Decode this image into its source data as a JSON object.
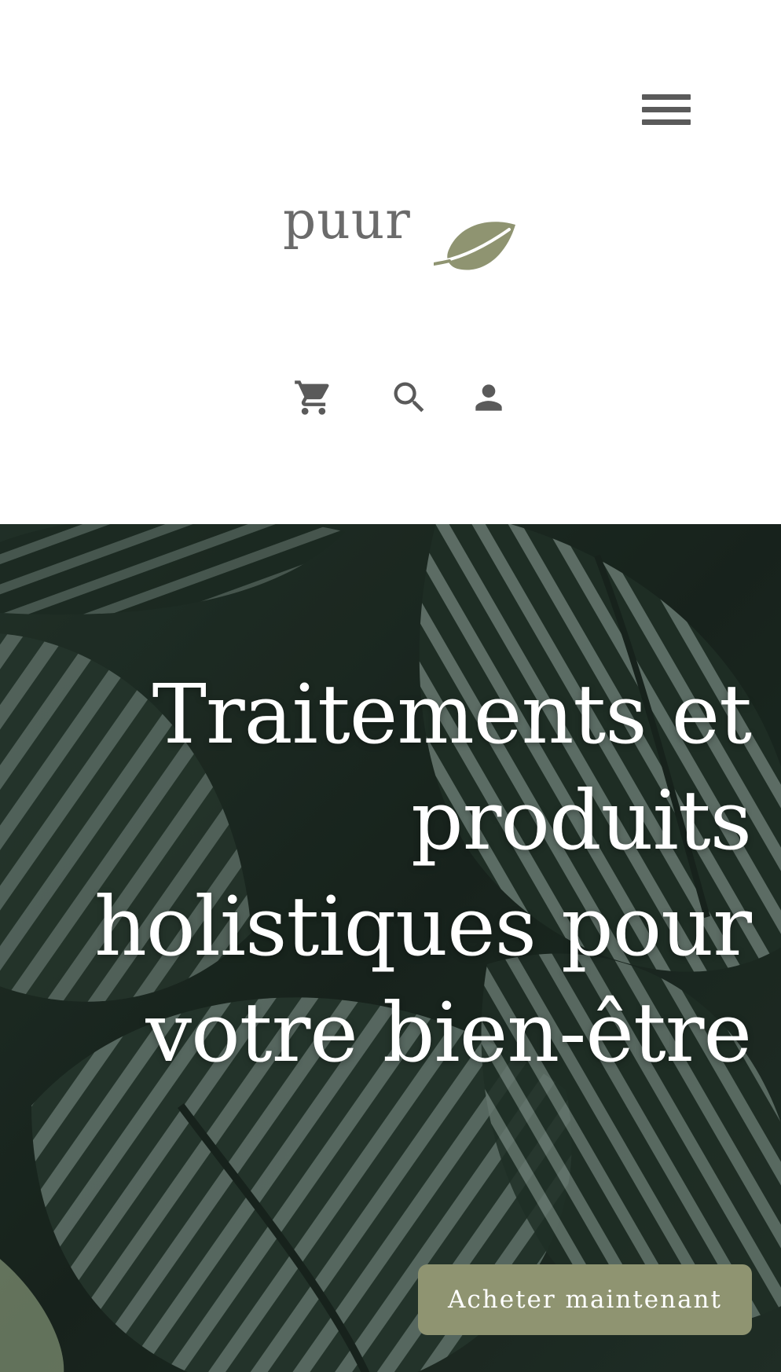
{
  "header": {
    "menu_icon": "hamburger-menu-icon",
    "logo": {
      "text": "puur",
      "leaf_icon": "leaf-icon",
      "text_color": "#6b6b6b",
      "leaf_color": "#8f9471"
    },
    "actions": [
      {
        "icon": "cart-icon"
      },
      {
        "icon": "search-icon"
      },
      {
        "icon": "account-icon"
      }
    ],
    "icon_color": "#5a5a5a"
  },
  "hero": {
    "title": "Traitements et produits holistiques pour votre bien-être",
    "background": "tropical-leaves-image",
    "cta_label": "Acheter maintenant",
    "cta_color": "#8f9471"
  }
}
